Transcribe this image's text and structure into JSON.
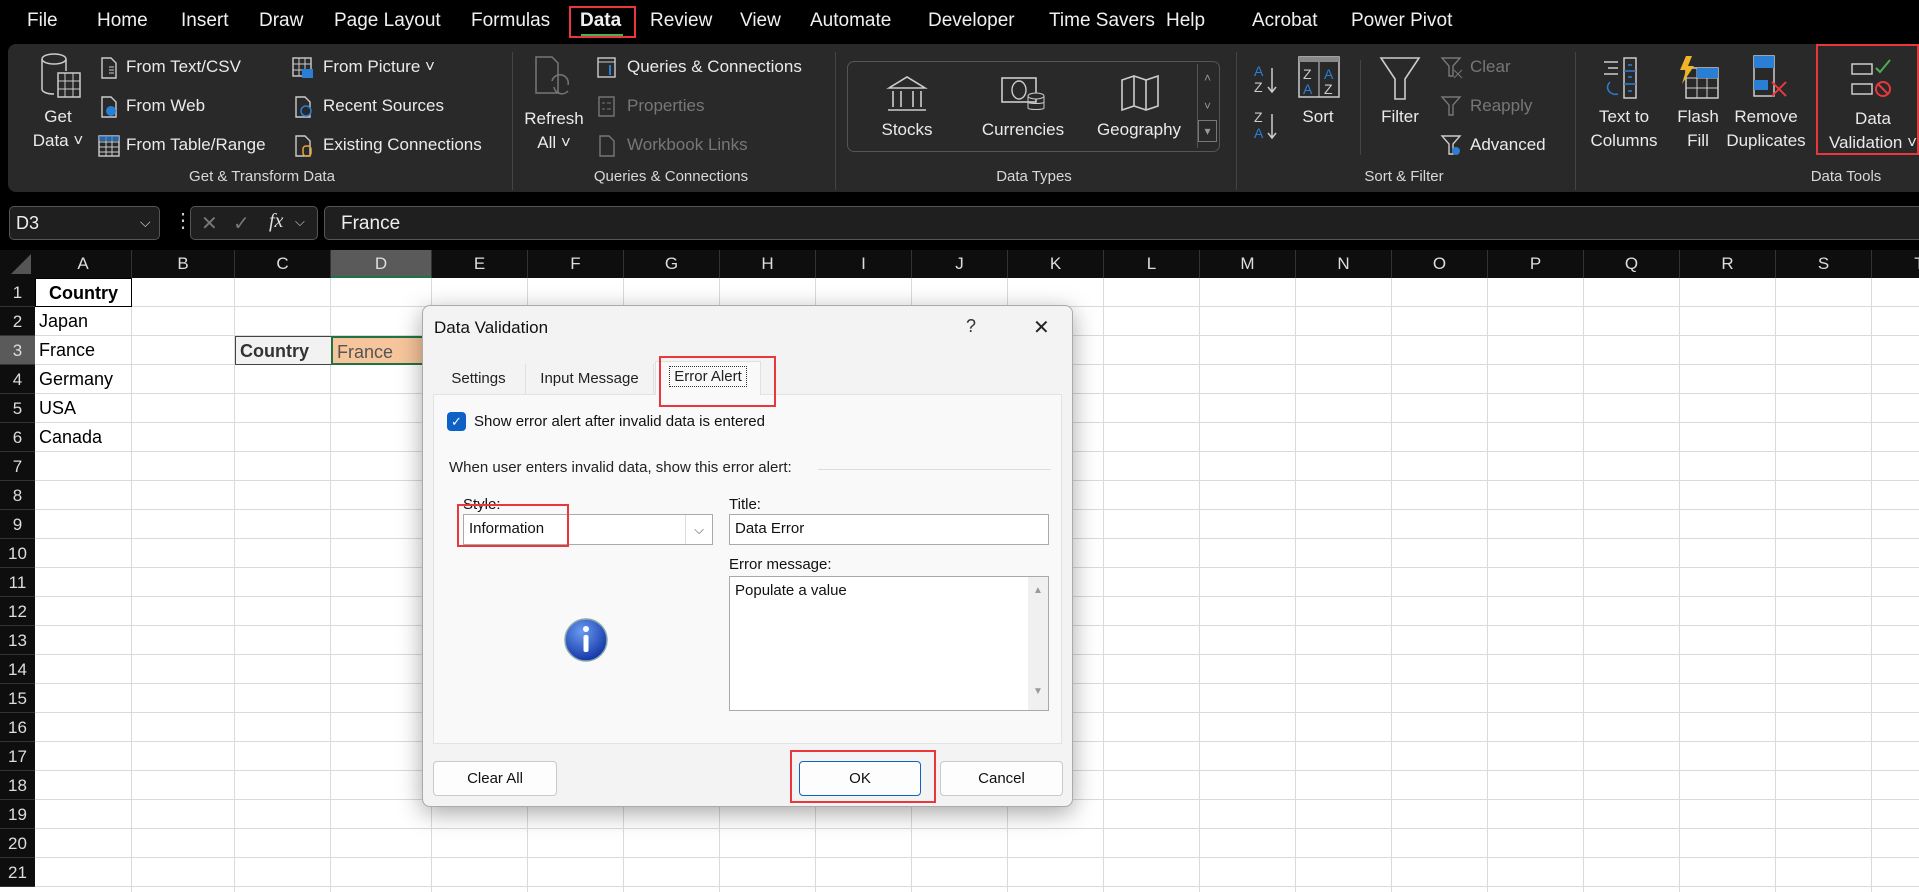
{
  "menu": [
    "File",
    "Home",
    "Insert",
    "Draw",
    "Page Layout",
    "Formulas",
    "Data",
    "Review",
    "View",
    "Automate",
    "Developer",
    "Time Savers",
    "Help",
    "Acrobat",
    "Power Pivot"
  ],
  "active_menu": "Data",
  "ribbon": {
    "get_transform": {
      "get": "Get",
      "data": "Data ˅",
      "from_text": "From Text/CSV",
      "from_web": "From Web",
      "from_table": "From Table/Range",
      "from_picture": "From Picture ˅",
      "recent": "Recent Sources",
      "existing": "Existing Connections",
      "label": "Get & Transform Data"
    },
    "queries": {
      "refresh": "Refresh",
      "all": "All ˅",
      "qc": "Queries & Connections",
      "properties": "Properties",
      "links": "Workbook Links",
      "label": "Queries & Connections"
    },
    "data_types": {
      "stocks": "Stocks",
      "currencies": "Currencies",
      "geography": "Geography",
      "label": "Data Types"
    },
    "sort_filter": {
      "sort": "Sort",
      "filter": "Filter",
      "clear": "Clear",
      "reapply": "Reapply",
      "advanced": "Advanced",
      "label": "Sort & Filter"
    },
    "data_tools": {
      "ttc1": "Text to",
      "ttc2": "Columns",
      "ff1": "Flash",
      "ff2": "Fill",
      "rd1": "Remove",
      "rd2": "Duplicates",
      "dv1": "Data",
      "dv2": "Validation ˅",
      "label": "Data Tools"
    }
  },
  "formula_bar": {
    "name_box": "D3",
    "fx": "fx",
    "value": "France"
  },
  "columns": [
    "A",
    "B",
    "C",
    "D",
    "E",
    "F",
    "G",
    "H",
    "I",
    "J",
    "K",
    "L",
    "M",
    "N",
    "O",
    "P",
    "Q",
    "R",
    "S",
    "T"
  ],
  "rows": [
    "1",
    "2",
    "3",
    "4",
    "5",
    "6",
    "7",
    "8",
    "9",
    "10",
    "11",
    "12",
    "13",
    "14",
    "15",
    "16",
    "17",
    "18",
    "19",
    "20",
    "21"
  ],
  "cells": {
    "A1": "Country",
    "A2": "Japan",
    "A3": "France",
    "A4": "Germany",
    "A5": "USA",
    "A6": "Canada",
    "C3": "Country",
    "D3": "France"
  },
  "dialog": {
    "title": "Data Validation",
    "help": "?",
    "close": "✕",
    "tabs": [
      "Settings",
      "Input Message",
      "Error Alert"
    ],
    "active_tab": "Error Alert",
    "show_alert_checked": true,
    "show_alert_label": "Show error alert after invalid data is entered",
    "group_label": "When user enters invalid data, show this error alert:",
    "style_label": "Style:",
    "style_value": "Information",
    "title_label": "Title:",
    "title_value": "Data Error",
    "message_label": "Error message:",
    "message_value": "Populate a value",
    "clear_all": "Clear All",
    "ok": "OK",
    "cancel": "Cancel"
  },
  "colors": {
    "accent": "#217346",
    "highlight_cell": "#f7c59b",
    "annotation": "#e8383d",
    "checkbox": "#0f62c5"
  }
}
